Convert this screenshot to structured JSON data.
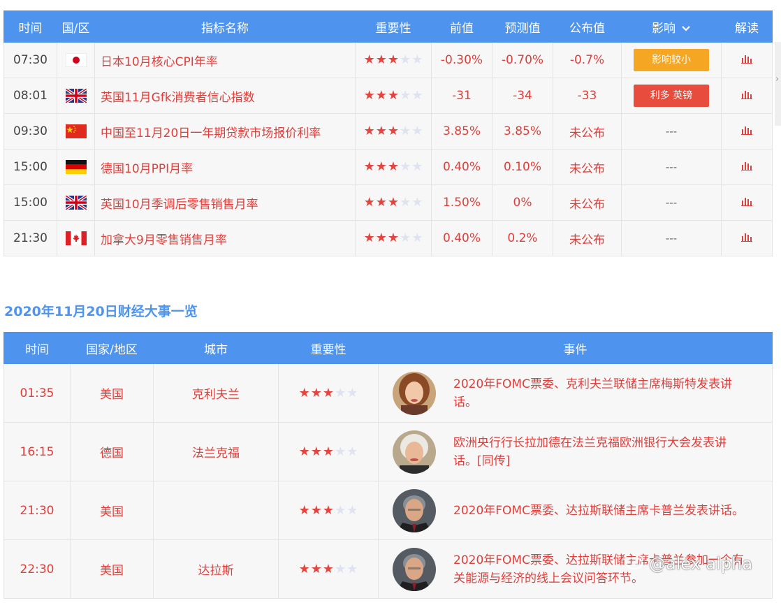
{
  "calendar": {
    "headers": {
      "time": "时间",
      "region": "国/区",
      "name": "指标名称",
      "importance": "重要性",
      "previous": "前值",
      "forecast": "预测值",
      "actual": "公布值",
      "impact": "影响",
      "analysis": "解读"
    },
    "rows": [
      {
        "time": "07:30",
        "flag": "japan-flag",
        "name": "日本10月核心CPI年率",
        "stars": 3,
        "previous": "-0.30%",
        "forecast": "-0.70%",
        "actual": "-0.7%",
        "impact": "影响较小"
      },
      {
        "time": "08:01",
        "flag": "uk-flag",
        "name": "英国11月Gfk消费者信心指数",
        "stars": 3,
        "previous": "-31",
        "forecast": "-34",
        "actual": "-33",
        "impact": "利多 英镑"
      },
      {
        "time": "09:30",
        "flag": "china-flag",
        "name": "中国至11月20日一年期贷款市场报价利率",
        "stars": 3,
        "previous": "3.85%",
        "forecast": "3.85%",
        "actual": "未公布",
        "impact": "---"
      },
      {
        "time": "15:00",
        "flag": "germany-flag",
        "name": "德国10月PPI月率",
        "stars": 3,
        "previous": "0.40%",
        "forecast": "0.10%",
        "actual": "未公布",
        "impact": "---"
      },
      {
        "time": "15:00",
        "flag": "uk-flag",
        "name": "英国10月季调后零售销售月率",
        "stars": 3,
        "previous": "1.50%",
        "forecast": "0%",
        "actual": "未公布",
        "impact": "---"
      },
      {
        "time": "21:30",
        "flag": "canada-flag",
        "name": "加拿大9月零售销售月率",
        "stars": 3,
        "previous": "0.40%",
        "forecast": "0.2%",
        "actual": "未公布",
        "impact": "---"
      }
    ]
  },
  "section_title": "2020年11月20日财经大事一览",
  "events": {
    "headers": {
      "time": "时间",
      "country": "国家/地区",
      "city": "城市",
      "importance": "重要性",
      "event": "事件"
    },
    "rows": [
      {
        "time": "01:35",
        "country": "美国",
        "city": "克利夫兰",
        "stars": 3,
        "avatar": "mester-avatar",
        "event": "2020年FOMC票委、克利夫兰联储主席梅斯特发表讲话。"
      },
      {
        "time": "16:15",
        "country": "德国",
        "city": "法兰克福",
        "stars": 3,
        "avatar": "lagarde-avatar",
        "event": "欧洲央行行长拉加德在法兰克福欧洲银行大会发表讲话。[同传]"
      },
      {
        "time": "21:30",
        "country": "美国",
        "city": "",
        "stars": 3,
        "avatar": "kaplan-avatar",
        "event": "2020年FOMC票委、达拉斯联储主席卡普兰发表讲话。"
      },
      {
        "time": "22:30",
        "country": "美国",
        "city": "达拉斯",
        "stars": 3,
        "avatar": "kaplan-avatar",
        "event": "2020年FOMC票委、达拉斯联储主席卡普兰参加一个有关能源与经济的线上会议问答环节。"
      }
    ]
  },
  "watermark": "@alex alpha",
  "colors": {
    "header_bg": "#4e94ee",
    "accent_red": "#e03e3a",
    "badge_orange": "#f5a623",
    "badge_red": "#e74c3c",
    "star_off": "#dfe3ef"
  }
}
